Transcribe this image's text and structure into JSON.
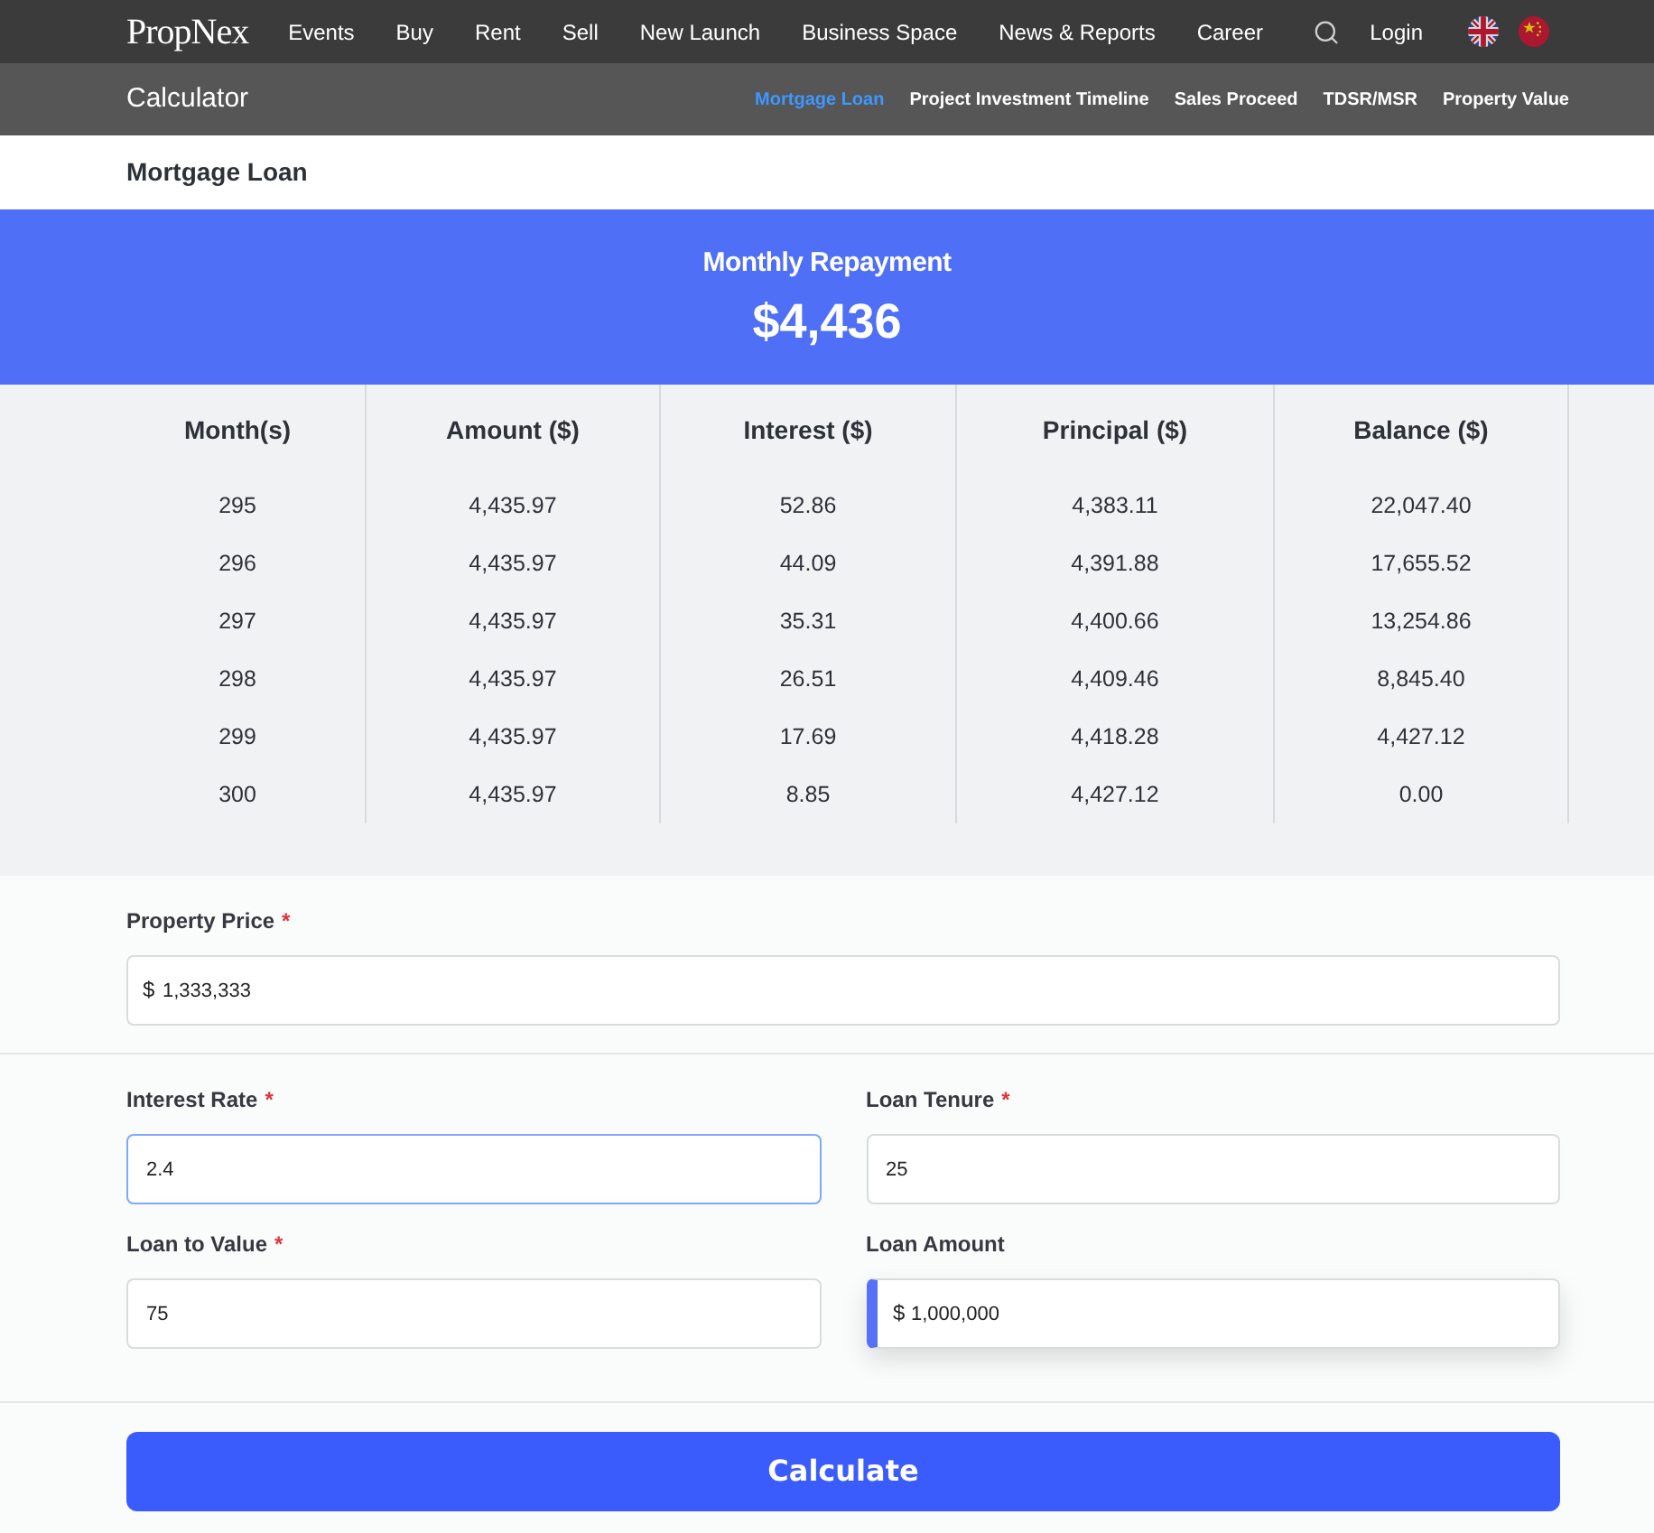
{
  "top_nav": {
    "logo": "PropNex",
    "items": [
      "Events",
      "Buy",
      "Rent",
      "Sell",
      "New Launch",
      "Business Space",
      "News & Reports",
      "Career"
    ],
    "login": "Login"
  },
  "sub_nav": {
    "title": "Calculator",
    "tabs": [
      {
        "label": "Mortgage Loan",
        "selected": true
      },
      {
        "label": "Project Investment Timeline",
        "selected": false
      },
      {
        "label": "Sales Proceed",
        "selected": false
      },
      {
        "label": "TDSR/MSR",
        "selected": false
      },
      {
        "label": "Property Value",
        "selected": false
      }
    ]
  },
  "section_title": "Mortgage Loan",
  "repayment": {
    "label": "Monthly Repayment",
    "amount": "$4,436"
  },
  "table": {
    "columns": [
      "Month(s)",
      "Amount ($)",
      "Interest ($)",
      "Principal ($)",
      "Balance ($)"
    ],
    "rows": [
      [
        "295",
        "4,435.97",
        "52.86",
        "4,383.11",
        "22,047.40"
      ],
      [
        "296",
        "4,435.97",
        "44.09",
        "4,391.88",
        "17,655.52"
      ],
      [
        "297",
        "4,435.97",
        "35.31",
        "4,400.66",
        "13,254.86"
      ],
      [
        "298",
        "4,435.97",
        "26.51",
        "4,409.46",
        "8,845.40"
      ],
      [
        "299",
        "4,435.97",
        "17.69",
        "4,418.28",
        "4,427.12"
      ],
      [
        "300",
        "4,435.97",
        "8.85",
        "4,427.12",
        "0.00"
      ]
    ]
  },
  "form": {
    "sections": [
      {
        "fields": [
          {
            "label": "Property Price",
            "required_mark": "*",
            "prefix": "$",
            "value": "1,333,333",
            "focused": false,
            "readonly": false
          }
        ]
      },
      {
        "fields": [
          {
            "label": "Interest Rate",
            "required_mark": "*",
            "value": "2.4",
            "focused": true,
            "readonly": false
          },
          {
            "label": "Loan Tenure",
            "required_mark": "*",
            "value": "25",
            "focused": false,
            "readonly": false
          },
          {
            "label": "Loan to Value",
            "required_mark": "*",
            "value": "75",
            "focused": false,
            "readonly": false
          },
          {
            "label": "Loan Amount",
            "prefix": "$",
            "value": "1,000,000",
            "focused": false,
            "readonly": true
          }
        ]
      }
    ]
  },
  "calculate_button": "Calculate"
}
